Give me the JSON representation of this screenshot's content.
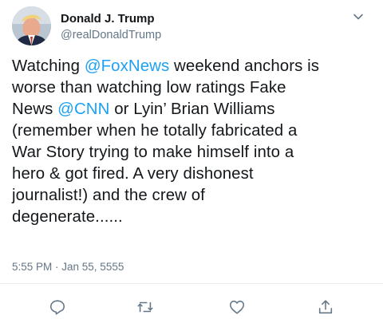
{
  "user": {
    "name": "Donald J. Trump",
    "handle": "@realDonaldTrump",
    "avatar_icon": "profile-photo"
  },
  "tweet": {
    "lines": [
      [
        {
          "text": "Watching "
        },
        {
          "text": "@FoxNews",
          "mention": true
        },
        {
          "text": " weekend anchors is"
        }
      ],
      [
        {
          "text": "worse than watching low ratings Fake"
        }
      ],
      [
        {
          "text": "News "
        },
        {
          "text": "@CNN",
          "mention": true
        },
        {
          "text": " or Lyin’ Brian Williams"
        }
      ],
      [
        {
          "text": "(remember when he totally fabricated a"
        }
      ],
      [
        {
          "text": "War Story trying to make himself into a"
        }
      ],
      [
        {
          "text": "hero & got fired. A very dishonest"
        }
      ],
      [
        {
          "text": "journalist!) and the crew of"
        }
      ],
      [
        {
          "text": "degenerate......"
        }
      ]
    ],
    "timestamp": "5:55 PM · Jan 55, 5555"
  },
  "actions": [
    {
      "name": "reply",
      "icon": "reply-icon"
    },
    {
      "name": "retweet",
      "icon": "retweet-icon"
    },
    {
      "name": "like",
      "icon": "heart-icon"
    },
    {
      "name": "share",
      "icon": "share-icon"
    }
  ],
  "colors": {
    "mention": "#1da1f2",
    "secondary_text": "#657786",
    "icon": "#657786",
    "divider": "#e6ecf0"
  }
}
